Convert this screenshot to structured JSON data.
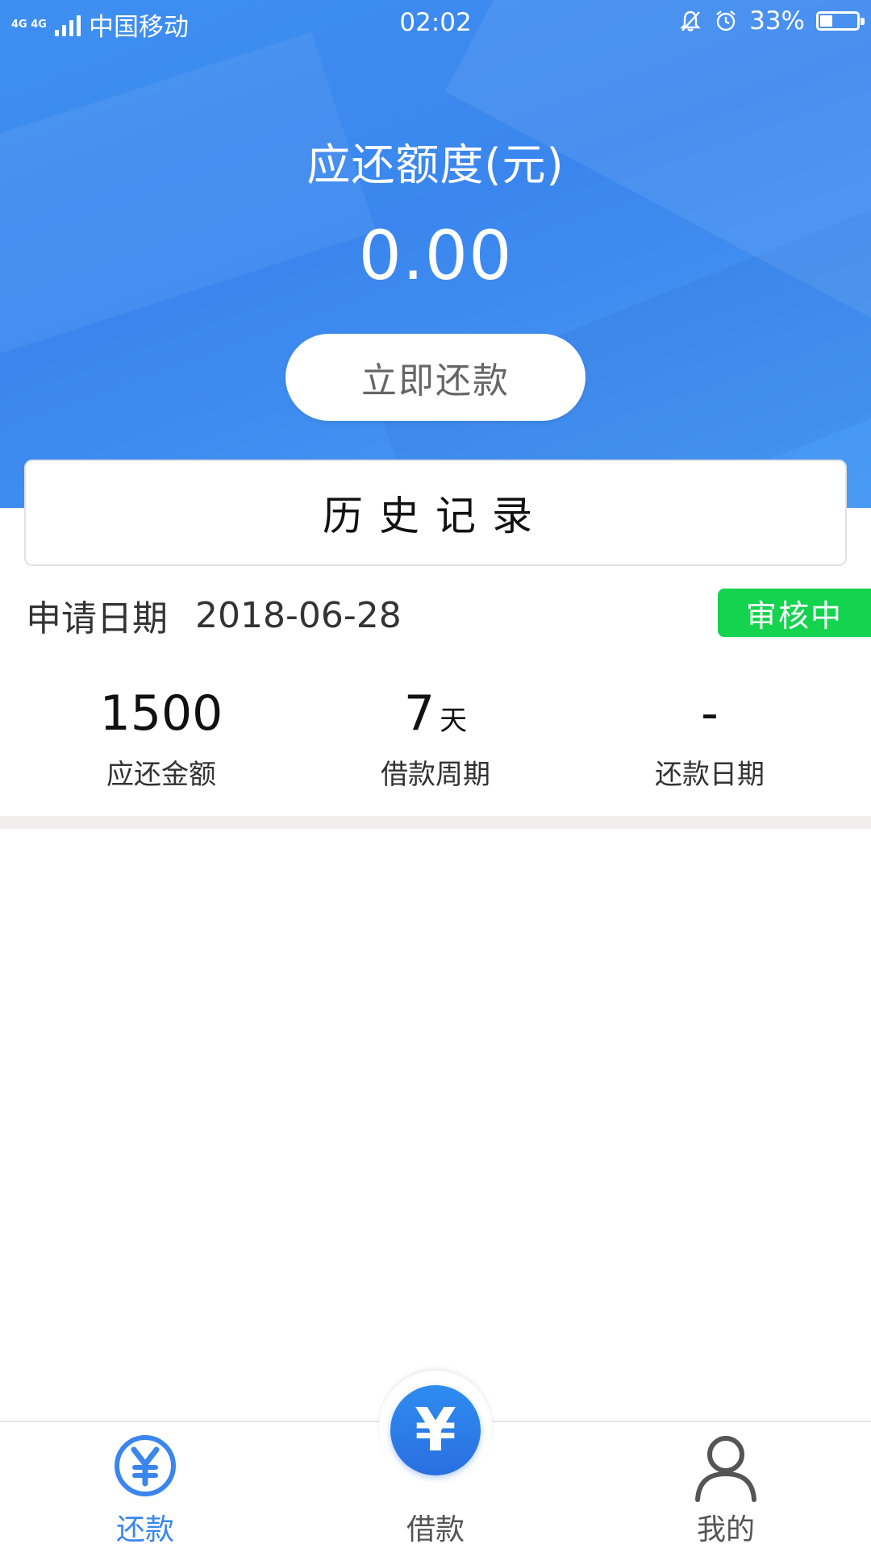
{
  "status_bar": {
    "network": "4G 4G",
    "carrier": "中国移动",
    "time": "02:02",
    "battery_text": "33%",
    "battery_level": 0.33,
    "icons": [
      "signal-icon",
      "mute-bell-icon",
      "alarm-icon",
      "battery-icon"
    ]
  },
  "hero": {
    "title": "应还额度(元)",
    "amount": "0.00",
    "repay_button": "立即还款"
  },
  "history": {
    "title": "历史记录"
  },
  "record": {
    "date_label": "申请日期",
    "date_value": "2018-06-28",
    "status": "审核中",
    "stats": [
      {
        "value": "1500",
        "unit": "",
        "label": "应还金额"
      },
      {
        "value": "7",
        "unit": "天",
        "label": "借款周期"
      },
      {
        "value": "-",
        "unit": "",
        "label": "还款日期"
      }
    ]
  },
  "tabbar": {
    "tabs": [
      {
        "label": "还款",
        "icon": "yen-circle-icon",
        "active": true
      },
      {
        "label": "借款",
        "icon": "yen-filled-circle-icon",
        "active": false
      },
      {
        "label": "我的",
        "icon": "user-icon",
        "active": false
      }
    ],
    "center_symbol": "¥"
  },
  "colors": {
    "primary": "#3a86ee",
    "status_green": "#14d34e",
    "text_dark": "#111111",
    "text_gray": "#666666"
  }
}
